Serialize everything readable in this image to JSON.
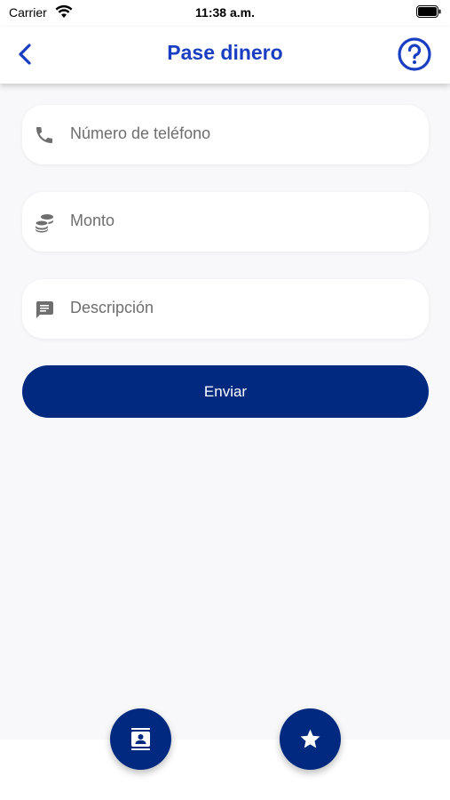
{
  "status_bar": {
    "carrier": "Carrier",
    "time": "11:38 a.m."
  },
  "nav": {
    "title": "Pase dinero",
    "back_icon": "chevron-left-icon",
    "help_icon": "question-circle-icon"
  },
  "form": {
    "phone": {
      "placeholder": "Número de teléfono",
      "icon": "phone-icon"
    },
    "amount": {
      "placeholder": "Monto",
      "icon": "coins-icon"
    },
    "description": {
      "placeholder": "Descripción",
      "icon": "message-icon"
    },
    "submit_label": "Enviar"
  },
  "actions": {
    "contacts_icon": "contacts-icon",
    "favorites_icon": "star-icon"
  },
  "colors": {
    "accent": "#1a3ec1",
    "primary": "#00297f",
    "background": "#f8f8fa"
  }
}
